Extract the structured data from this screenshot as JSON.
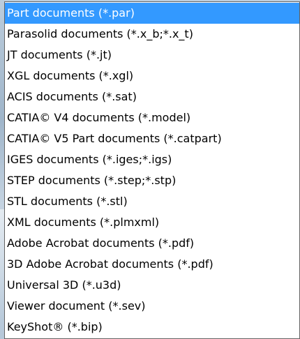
{
  "dropdown": {
    "selected_index": 0,
    "selection_color": "#3399ff",
    "options": [
      "Part documents (*.par)",
      "Parasolid documents (*.x_b;*.x_t)",
      "JT documents (*.jt)",
      "XGL documents (*.xgl)",
      "ACIS documents (*.sat)",
      "CATIA© V4 documents (*.model)",
      "CATIA© V5 Part documents (*.catpart)",
      "IGES documents (*.iges;*.igs)",
      "STEP documents (*.step;*.stp)",
      "STL documents (*.stl)",
      "XML documents (*.plmxml)",
      "Adobe Acrobat documents (*.pdf)",
      "3D Adobe Acrobat documents (*.pdf)",
      "Universal 3D (*.u3d)",
      "Viewer document (*.sev)",
      "KeyShot® (*.bip)"
    ]
  }
}
